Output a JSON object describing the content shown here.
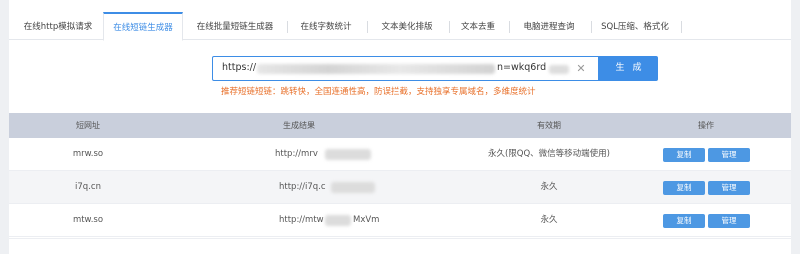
{
  "tabs": [
    {
      "label": "在线http模拟请求",
      "active": false
    },
    {
      "label": "在线短链生成器",
      "active": true
    },
    {
      "label": "在线批量短链生成器",
      "active": false
    },
    {
      "label": "在线字数统计",
      "active": false
    },
    {
      "label": "文本美化排版",
      "active": false
    },
    {
      "label": "文本去重",
      "active": false
    },
    {
      "label": "电脑进程查询",
      "active": false
    },
    {
      "label": "SQL压缩、格式化",
      "active": false
    }
  ],
  "url_input": {
    "prefix": "https://",
    "suffix": "n=wkq6rd",
    "clear_glyph": "✕"
  },
  "generate_button": "生成",
  "tip": "推荐短链短链：跳转快，全国连通性高，防误拦截，支持独享专属域名，多维度统计",
  "table": {
    "headers": [
      "短网址",
      "生成结果",
      "有效期",
      "操作"
    ],
    "rows": [
      {
        "domain": "mrw.so",
        "result_visible": "http://mrv",
        "validity": "永久(限QQ、微信等移动端使用)",
        "copy": "复制",
        "manage": "管理"
      },
      {
        "domain": "i7q.cn",
        "result_visible": "http://i7q.c",
        "validity": "永久",
        "copy": "复制",
        "manage": "管理"
      },
      {
        "domain": "mtw.so",
        "result_visible": "http://mtw",
        "result_tail": "MxVm",
        "validity": "永久",
        "copy": "复制",
        "manage": "管理"
      }
    ]
  },
  "colors": {
    "accent": "#3d8de6",
    "tip": "#e8702a",
    "header_bg": "#c9cfdc",
    "button": "#4d98e3"
  }
}
